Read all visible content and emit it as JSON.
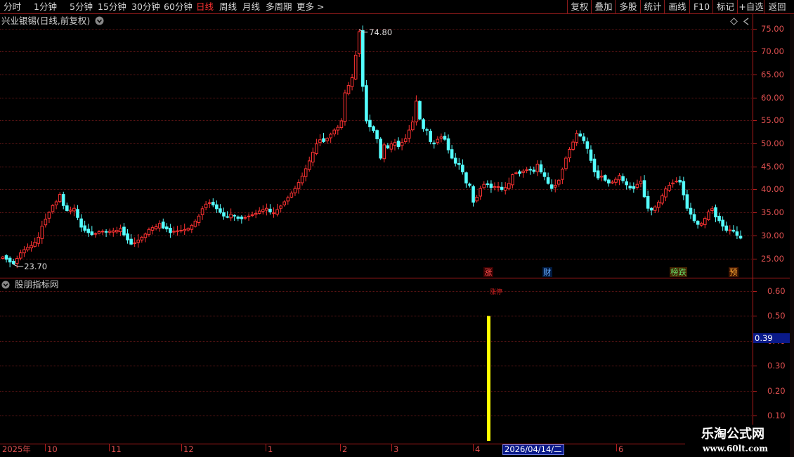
{
  "toolbar": {
    "periods": [
      "分时",
      "1分钟",
      "5分钟",
      "15分钟",
      "30分钟",
      "60分钟",
      "日线",
      "周线",
      "月线",
      "多周期",
      "更多 >"
    ],
    "active_period": "日线",
    "actions": [
      "复权",
      "叠加",
      "多股",
      "统计",
      "画线",
      "F10",
      "标记",
      "+自选",
      "返回"
    ]
  },
  "kline_pane": {
    "title": "兴业银锡(日线,前复权)",
    "high_label": "74.80",
    "low_label": "23.70",
    "y_ticks": [
      "75.00",
      "70.00",
      "65.00",
      "60.00",
      "55.00",
      "50.00",
      "45.00",
      "40.00",
      "35.00",
      "30.00",
      "25.00"
    ],
    "signals": [
      {
        "text": "涨",
        "color": "#ff5050",
        "bg": "#3a0000"
      },
      {
        "text": "财",
        "color": "#66aaff",
        "bg": "#001a40"
      },
      {
        "text": "榜跌",
        "color": "#66dd66",
        "bg": "#402000"
      },
      {
        "text": "预",
        "color": "#ffaa33",
        "bg": "#401400"
      }
    ]
  },
  "indicator_pane": {
    "title": "股朋指标网",
    "bar_label": "涨停",
    "current_value": "0.39",
    "y_ticks": [
      "0.60",
      "0.50",
      "0.40",
      "0.30",
      "0.20",
      "0.10"
    ]
  },
  "date_axis": {
    "labels": [
      "2025年",
      "10",
      "11",
      "12",
      "1",
      "2",
      "3",
      "4",
      "6"
    ],
    "cursor_date": "2026/04/14/二"
  },
  "watermark": {
    "line1": "乐淘公式网",
    "line2": "www.60lt.com"
  },
  "chart_data": [
    {
      "type": "candlestick",
      "title": "兴业银锡(日线,前复权)",
      "ylim": [
        22,
        77
      ],
      "max_label": 74.8,
      "min_label": 23.7,
      "up_color": "#ff3232",
      "down_color": "#54ffff",
      "closes": [
        25.3,
        24.8,
        24.2,
        23.8,
        25.0,
        26.2,
        26.9,
        27.4,
        27.8,
        28.5,
        29.6,
        32.0,
        33.5,
        35.0,
        36.5,
        37.3,
        38.9,
        36.5,
        35.4,
        35.5,
        35.9,
        33.9,
        31.8,
        31.1,
        30.6,
        30.2,
        30.4,
        30.8,
        30.9,
        30.8,
        30.9,
        31.0,
        31.1,
        31.5,
        30.1,
        29.0,
        28.1,
        28.4,
        29.0,
        29.6,
        30.3,
        31.3,
        31.7,
        31.9,
        32.6,
        31.6,
        31.4,
        30.6,
        30.9,
        31.0,
        31.1,
        31.3,
        31.5,
        32.2,
        33.1,
        34.2,
        35.8,
        36.8,
        37.1,
        36.6,
        35.8,
        35.0,
        34.2,
        34.0,
        34.6,
        34.3,
        33.7,
        33.6,
        33.9,
        34.2,
        34.5,
        34.8,
        35.3,
        35.6,
        35.9,
        35.1,
        34.9,
        35.6,
        36.4,
        37.3,
        38.2,
        39.2,
        40.2,
        41.5,
        42.9,
        44.5,
        46.2,
        48.1,
        49.9,
        50.8,
        50.4,
        51.1,
        52.0,
        52.9,
        53.5,
        54.9,
        61.0,
        62.6,
        64.3,
        69.2,
        74.3,
        62.4,
        54.9,
        53.6,
        52.8,
        51.0,
        46.8,
        49.7,
        49.0,
        49.9,
        50.2,
        49.3,
        50.2,
        51.0,
        52.9,
        54.7,
        59.2,
        55.3,
        53.2,
        52.9,
        50.4,
        49.9,
        50.9,
        51.4,
        50.9,
        48.6,
        46.8,
        45.7,
        45.4,
        43.8,
        41.4,
        40.9,
        37.2,
        38.3,
        40.2,
        41.1,
        41.1,
        40.4,
        40.6,
        40.6,
        40.0,
        40.4,
        41.3,
        43.2,
        43.6,
        43.5,
        44.0,
        44.3,
        44.2,
        43.9,
        45.5,
        43.8,
        42.8,
        41.3,
        40.2,
        40.9,
        42.0,
        44.4,
        46.8,
        48.7,
        50.3,
        52.2,
        51.6,
        50.6,
        48.9,
        46.3,
        43.8,
        42.5,
        42.9,
        42.0,
        41.4,
        41.6,
        42.2,
        43.0,
        41.9,
        41.0,
        40.3,
        40.2,
        41.1,
        41.8,
        38.4,
        35.9,
        35.5,
        36.2,
        37.2,
        38.6,
        40.1,
        40.9,
        41.4,
        41.8,
        41.6,
        38.8,
        35.9,
        34.6,
        33.2,
        32.4,
        32.6,
        33.7,
        35.1,
        35.8,
        34.0,
        33.2,
        32.0,
        31.1,
        31.2,
        30.9,
        30.0,
        29.4
      ]
    },
    {
      "type": "bar",
      "title": "股朋指标网",
      "ylim": [
        0.05,
        0.65
      ],
      "bars": [
        {
          "date": "2026/04/14/二",
          "value": 0.5
        }
      ],
      "current_value": 0.39,
      "bar_color": "#ffff00"
    }
  ]
}
